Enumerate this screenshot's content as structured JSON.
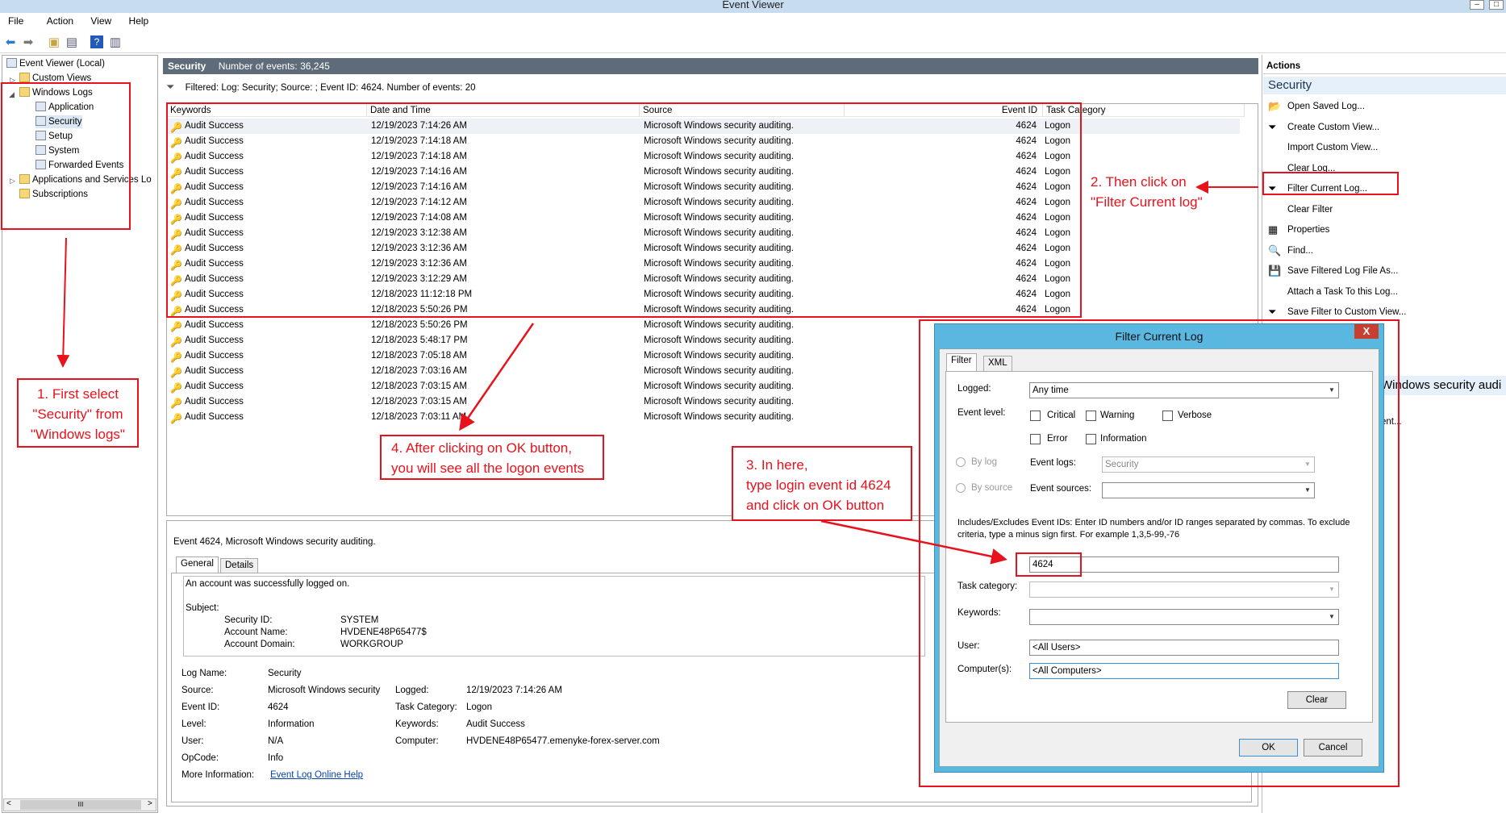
{
  "window": {
    "title": "Event Viewer"
  },
  "menu": [
    "File",
    "Action",
    "View",
    "Help"
  ],
  "tree": {
    "root": "Event Viewer (Local)",
    "custom_views": "Custom Views",
    "windows_logs": "Windows Logs",
    "children": [
      "Application",
      "Security",
      "Setup",
      "System",
      "Forwarded Events"
    ],
    "apps_services": "Applications and Services Lo",
    "subscriptions": "Subscriptions",
    "scroll_glyph": "III"
  },
  "center": {
    "log_name": "Security",
    "event_count": "Number of events: 36,245",
    "filter_text": "Filtered: Log: Security; Source: ; Event ID: 4624. Number of events: 20",
    "columns": [
      "Keywords",
      "Date and Time",
      "Source",
      "Event ID",
      "Task Category"
    ],
    "rows": [
      [
        "Audit Success",
        "12/19/2023 7:14:26 AM",
        "Microsoft Windows security auditing.",
        "4624",
        "Logon"
      ],
      [
        "Audit Success",
        "12/19/2023 7:14:18 AM",
        "Microsoft Windows security auditing.",
        "4624",
        "Logon"
      ],
      [
        "Audit Success",
        "12/19/2023 7:14:18 AM",
        "Microsoft Windows security auditing.",
        "4624",
        "Logon"
      ],
      [
        "Audit Success",
        "12/19/2023 7:14:16 AM",
        "Microsoft Windows security auditing.",
        "4624",
        "Logon"
      ],
      [
        "Audit Success",
        "12/19/2023 7:14:16 AM",
        "Microsoft Windows security auditing.",
        "4624",
        "Logon"
      ],
      [
        "Audit Success",
        "12/19/2023 7:14:12 AM",
        "Microsoft Windows security auditing.",
        "4624",
        "Logon"
      ],
      [
        "Audit Success",
        "12/19/2023 7:14:08 AM",
        "Microsoft Windows security auditing.",
        "4624",
        "Logon"
      ],
      [
        "Audit Success",
        "12/19/2023 3:12:38 AM",
        "Microsoft Windows security auditing.",
        "4624",
        "Logon"
      ],
      [
        "Audit Success",
        "12/19/2023 3:12:36 AM",
        "Microsoft Windows security auditing.",
        "4624",
        "Logon"
      ],
      [
        "Audit Success",
        "12/19/2023 3:12:36 AM",
        "Microsoft Windows security auditing.",
        "4624",
        "Logon"
      ],
      [
        "Audit Success",
        "12/19/2023 3:12:29 AM",
        "Microsoft Windows security auditing.",
        "4624",
        "Logon"
      ],
      [
        "Audit Success",
        "12/18/2023 11:12:18 PM",
        "Microsoft Windows security auditing.",
        "4624",
        "Logon"
      ],
      [
        "Audit Success",
        "12/18/2023 5:50:26 PM",
        "Microsoft Windows security auditing.",
        "4624",
        "Logon"
      ],
      [
        "Audit Success",
        "12/18/2023 5:50:26 PM",
        "Microsoft Windows security auditing.",
        "",
        ""
      ],
      [
        "Audit Success",
        "12/18/2023 5:48:17 PM",
        "Microsoft Windows security auditing.",
        "",
        ""
      ],
      [
        "Audit Success",
        "12/18/2023 7:05:18 AM",
        "Microsoft Windows security auditing.",
        "",
        ""
      ],
      [
        "Audit Success",
        "12/18/2023 7:03:16 AM",
        "Microsoft Windows security auditing.",
        "",
        ""
      ],
      [
        "Audit Success",
        "12/18/2023 7:03:15 AM",
        "Microsoft Windows security auditing.",
        "",
        ""
      ],
      [
        "Audit Success",
        "12/18/2023 7:03:15 AM",
        "Microsoft Windows security auditing.",
        "",
        ""
      ],
      [
        "Audit Success",
        "12/18/2023 7:03:11 AM",
        "Microsoft Windows security auditing.",
        "",
        ""
      ]
    ]
  },
  "detail": {
    "header": "Event 4624, Microsoft Windows security auditing.",
    "tabs": [
      "General",
      "Details"
    ],
    "message": "An account was successfully logged on.",
    "subject_label": "Subject:",
    "subject": [
      [
        "Security ID:",
        "SYSTEM"
      ],
      [
        "Account Name:",
        "HVDENE48P65477$"
      ],
      [
        "Account Domain:",
        "WORKGROUP"
      ]
    ],
    "fields_left": [
      [
        "Log Name:",
        "Security"
      ],
      [
        "Source:",
        "Microsoft Windows security"
      ],
      [
        "Event ID:",
        "4624"
      ],
      [
        "Level:",
        "Information"
      ],
      [
        "User:",
        "N/A"
      ],
      [
        "OpCode:",
        "Info"
      ]
    ],
    "fields_right": [
      [
        "Logged:",
        "12/19/2023 7:14:26 AM"
      ],
      [
        "Task Category:",
        "Logon"
      ],
      [
        "Keywords:",
        "Audit Success"
      ],
      [
        "Computer:",
        "HVDENE48P65477.emenyke-forex-server.com"
      ]
    ],
    "more_info_label": "More Information:",
    "more_info_link": "Event Log Online Help"
  },
  "actions": {
    "header": "Actions",
    "section": "Security",
    "items": [
      "Open Saved Log...",
      "Create Custom View...",
      "Import Custom View...",
      "Clear Log...",
      "Filter Current Log...",
      "Clear Filter",
      "Properties",
      "Find...",
      "Save Filtered Log File As...",
      "Attach a Task To this Log...",
      "Save Filter to Custom View...",
      "View"
    ],
    "partial_section": "Windows security audi",
    "partial_item": "ent..."
  },
  "dialog": {
    "title": "Filter Current Log",
    "close": "X",
    "tabs": [
      "Filter",
      "XML"
    ],
    "logged_label": "Logged:",
    "logged_value": "Any time",
    "event_level_label": "Event level:",
    "levels": [
      "Critical",
      "Warning",
      "Verbose",
      "Error",
      "Information"
    ],
    "by_log": "By log",
    "by_source": "By source",
    "event_logs_label": "Event logs:",
    "event_logs_value": "Security",
    "event_sources_label": "Event sources:",
    "ids_help": "Includes/Excludes Event IDs: Enter ID numbers and/or ID ranges separated by commas. To exclude criteria, type a minus sign first. For example 1,3,5-99,-76",
    "event_id_value": "4624",
    "task_category_label": "Task category:",
    "keywords_label": "Keywords:",
    "user_label": "User:",
    "user_value": "<All Users>",
    "computers_label": "Computer(s):",
    "computers_value": "<All Computers>",
    "clear_button": "Clear",
    "ok_button": "OK",
    "cancel_button": "Cancel"
  },
  "annotations": {
    "step1": [
      "1. First select",
      "\"Security\" from",
      "\"Windows logs\""
    ],
    "step2": [
      "2. Then click on",
      "\"Filter Current log\""
    ],
    "step3": [
      "3. In here,",
      "type login event id 4624",
      "and click on OK button"
    ],
    "step4": [
      "4. After clicking on OK button,",
      "you will see all the logon events"
    ],
    "color": "#e8121c"
  }
}
